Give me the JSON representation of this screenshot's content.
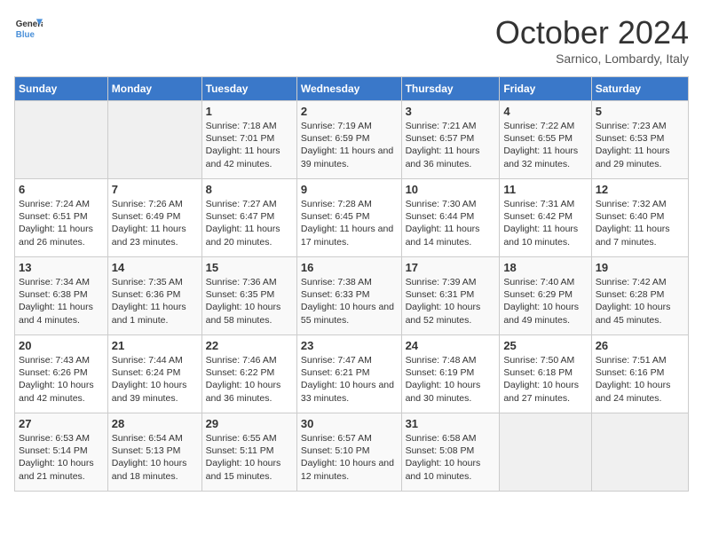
{
  "header": {
    "logo_line1": "General",
    "logo_line2": "Blue",
    "month": "October 2024",
    "location": "Sarnico, Lombardy, Italy"
  },
  "weekdays": [
    "Sunday",
    "Monday",
    "Tuesday",
    "Wednesday",
    "Thursday",
    "Friday",
    "Saturday"
  ],
  "weeks": [
    [
      {
        "day": "",
        "sunrise": "",
        "sunset": "",
        "daylight": ""
      },
      {
        "day": "",
        "sunrise": "",
        "sunset": "",
        "daylight": ""
      },
      {
        "day": "1",
        "sunrise": "Sunrise: 7:18 AM",
        "sunset": "Sunset: 7:01 PM",
        "daylight": "Daylight: 11 hours and 42 minutes."
      },
      {
        "day": "2",
        "sunrise": "Sunrise: 7:19 AM",
        "sunset": "Sunset: 6:59 PM",
        "daylight": "Daylight: 11 hours and 39 minutes."
      },
      {
        "day": "3",
        "sunrise": "Sunrise: 7:21 AM",
        "sunset": "Sunset: 6:57 PM",
        "daylight": "Daylight: 11 hours and 36 minutes."
      },
      {
        "day": "4",
        "sunrise": "Sunrise: 7:22 AM",
        "sunset": "Sunset: 6:55 PM",
        "daylight": "Daylight: 11 hours and 32 minutes."
      },
      {
        "day": "5",
        "sunrise": "Sunrise: 7:23 AM",
        "sunset": "Sunset: 6:53 PM",
        "daylight": "Daylight: 11 hours and 29 minutes."
      }
    ],
    [
      {
        "day": "6",
        "sunrise": "Sunrise: 7:24 AM",
        "sunset": "Sunset: 6:51 PM",
        "daylight": "Daylight: 11 hours and 26 minutes."
      },
      {
        "day": "7",
        "sunrise": "Sunrise: 7:26 AM",
        "sunset": "Sunset: 6:49 PM",
        "daylight": "Daylight: 11 hours and 23 minutes."
      },
      {
        "day": "8",
        "sunrise": "Sunrise: 7:27 AM",
        "sunset": "Sunset: 6:47 PM",
        "daylight": "Daylight: 11 hours and 20 minutes."
      },
      {
        "day": "9",
        "sunrise": "Sunrise: 7:28 AM",
        "sunset": "Sunset: 6:45 PM",
        "daylight": "Daylight: 11 hours and 17 minutes."
      },
      {
        "day": "10",
        "sunrise": "Sunrise: 7:30 AM",
        "sunset": "Sunset: 6:44 PM",
        "daylight": "Daylight: 11 hours and 14 minutes."
      },
      {
        "day": "11",
        "sunrise": "Sunrise: 7:31 AM",
        "sunset": "Sunset: 6:42 PM",
        "daylight": "Daylight: 11 hours and 10 minutes."
      },
      {
        "day": "12",
        "sunrise": "Sunrise: 7:32 AM",
        "sunset": "Sunset: 6:40 PM",
        "daylight": "Daylight: 11 hours and 7 minutes."
      }
    ],
    [
      {
        "day": "13",
        "sunrise": "Sunrise: 7:34 AM",
        "sunset": "Sunset: 6:38 PM",
        "daylight": "Daylight: 11 hours and 4 minutes."
      },
      {
        "day": "14",
        "sunrise": "Sunrise: 7:35 AM",
        "sunset": "Sunset: 6:36 PM",
        "daylight": "Daylight: 11 hours and 1 minute."
      },
      {
        "day": "15",
        "sunrise": "Sunrise: 7:36 AM",
        "sunset": "Sunset: 6:35 PM",
        "daylight": "Daylight: 10 hours and 58 minutes."
      },
      {
        "day": "16",
        "sunrise": "Sunrise: 7:38 AM",
        "sunset": "Sunset: 6:33 PM",
        "daylight": "Daylight: 10 hours and 55 minutes."
      },
      {
        "day": "17",
        "sunrise": "Sunrise: 7:39 AM",
        "sunset": "Sunset: 6:31 PM",
        "daylight": "Daylight: 10 hours and 52 minutes."
      },
      {
        "day": "18",
        "sunrise": "Sunrise: 7:40 AM",
        "sunset": "Sunset: 6:29 PM",
        "daylight": "Daylight: 10 hours and 49 minutes."
      },
      {
        "day": "19",
        "sunrise": "Sunrise: 7:42 AM",
        "sunset": "Sunset: 6:28 PM",
        "daylight": "Daylight: 10 hours and 45 minutes."
      }
    ],
    [
      {
        "day": "20",
        "sunrise": "Sunrise: 7:43 AM",
        "sunset": "Sunset: 6:26 PM",
        "daylight": "Daylight: 10 hours and 42 minutes."
      },
      {
        "day": "21",
        "sunrise": "Sunrise: 7:44 AM",
        "sunset": "Sunset: 6:24 PM",
        "daylight": "Daylight: 10 hours and 39 minutes."
      },
      {
        "day": "22",
        "sunrise": "Sunrise: 7:46 AM",
        "sunset": "Sunset: 6:22 PM",
        "daylight": "Daylight: 10 hours and 36 minutes."
      },
      {
        "day": "23",
        "sunrise": "Sunrise: 7:47 AM",
        "sunset": "Sunset: 6:21 PM",
        "daylight": "Daylight: 10 hours and 33 minutes."
      },
      {
        "day": "24",
        "sunrise": "Sunrise: 7:48 AM",
        "sunset": "Sunset: 6:19 PM",
        "daylight": "Daylight: 10 hours and 30 minutes."
      },
      {
        "day": "25",
        "sunrise": "Sunrise: 7:50 AM",
        "sunset": "Sunset: 6:18 PM",
        "daylight": "Daylight: 10 hours and 27 minutes."
      },
      {
        "day": "26",
        "sunrise": "Sunrise: 7:51 AM",
        "sunset": "Sunset: 6:16 PM",
        "daylight": "Daylight: 10 hours and 24 minutes."
      }
    ],
    [
      {
        "day": "27",
        "sunrise": "Sunrise: 6:53 AM",
        "sunset": "Sunset: 5:14 PM",
        "daylight": "Daylight: 10 hours and 21 minutes."
      },
      {
        "day": "28",
        "sunrise": "Sunrise: 6:54 AM",
        "sunset": "Sunset: 5:13 PM",
        "daylight": "Daylight: 10 hours and 18 minutes."
      },
      {
        "day": "29",
        "sunrise": "Sunrise: 6:55 AM",
        "sunset": "Sunset: 5:11 PM",
        "daylight": "Daylight: 10 hours and 15 minutes."
      },
      {
        "day": "30",
        "sunrise": "Sunrise: 6:57 AM",
        "sunset": "Sunset: 5:10 PM",
        "daylight": "Daylight: 10 hours and 12 minutes."
      },
      {
        "day": "31",
        "sunrise": "Sunrise: 6:58 AM",
        "sunset": "Sunset: 5:08 PM",
        "daylight": "Daylight: 10 hours and 10 minutes."
      },
      {
        "day": "",
        "sunrise": "",
        "sunset": "",
        "daylight": ""
      },
      {
        "day": "",
        "sunrise": "",
        "sunset": "",
        "daylight": ""
      }
    ]
  ]
}
